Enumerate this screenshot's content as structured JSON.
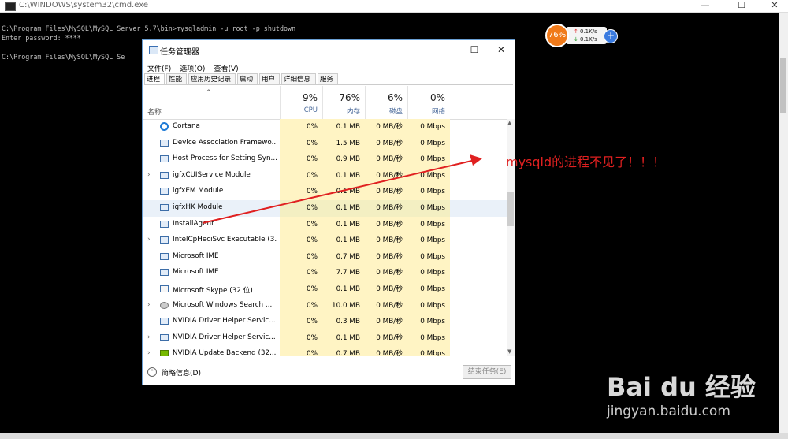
{
  "cmd": {
    "title": "C:\\WINDOWS\\system32\\cmd.exe",
    "lines": [
      "C:\\Program Files\\MySQL\\MySQL Server 5.7\\bin>mysqladmin -u root -p shutdown",
      "Enter password: ****",
      "",
      "C:\\Program Files\\MySQL\\MySQL Se"
    ],
    "min": "—",
    "max": "☐",
    "close": "✕"
  },
  "net_widget": {
    "percent": "76%",
    "up": "0.1K/s",
    "down": "0.1K/s",
    "plus": "+"
  },
  "taskmgr": {
    "title": "任务管理器",
    "min": "—",
    "max": "☐",
    "close": "✕",
    "menu": [
      "文件(F)",
      "选项(O)",
      "查看(V)"
    ],
    "tabs": [
      "进程",
      "性能",
      "应用历史记录",
      "启动",
      "用户",
      "详细信息",
      "服务"
    ],
    "columns": {
      "name": "名称",
      "sort_arrow": "^",
      "cpu": {
        "pct": "9%",
        "label": "CPU"
      },
      "mem": {
        "pct": "76%",
        "label": "内存"
      },
      "disk": {
        "pct": "6%",
        "label": "磁盘"
      },
      "net": {
        "pct": "0%",
        "label": "网络"
      }
    },
    "rows": [
      {
        "name": "Cortana",
        "expand": "",
        "icon": "cortana",
        "cpu": "0%",
        "mem": "0.1 MB",
        "disk": "0 MB/秒",
        "net": "0 Mbps"
      },
      {
        "name": "Device Association Framewo...",
        "expand": "",
        "icon": "app",
        "cpu": "0%",
        "mem": "1.5 MB",
        "disk": "0 MB/秒",
        "net": "0 Mbps"
      },
      {
        "name": "Host Process for Setting Syn...",
        "expand": "",
        "icon": "app",
        "cpu": "0%",
        "mem": "0.9 MB",
        "disk": "0 MB/秒",
        "net": "0 Mbps"
      },
      {
        "name": "igfxCUIService Module",
        "expand": "›",
        "icon": "app",
        "cpu": "0%",
        "mem": "0.1 MB",
        "disk": "0 MB/秒",
        "net": "0 Mbps"
      },
      {
        "name": "igfxEM Module",
        "expand": "",
        "icon": "app",
        "cpu": "0%",
        "mem": "0.1 MB",
        "disk": "0 MB/秒",
        "net": "0 Mbps"
      },
      {
        "name": "igfxHK Module",
        "expand": "",
        "icon": "app",
        "cpu": "0%",
        "mem": "0.1 MB",
        "disk": "0 MB/秒",
        "net": "0 Mbps"
      },
      {
        "name": "InstallAgent",
        "expand": "",
        "icon": "app",
        "cpu": "0%",
        "mem": "0.1 MB",
        "disk": "0 MB/秒",
        "net": "0 Mbps"
      },
      {
        "name": "IntelCpHeciSvc Executable (3...",
        "expand": "›",
        "icon": "app",
        "cpu": "0%",
        "mem": "0.1 MB",
        "disk": "0 MB/秒",
        "net": "0 Mbps"
      },
      {
        "name": "Microsoft IME",
        "expand": "",
        "icon": "app",
        "cpu": "0%",
        "mem": "0.7 MB",
        "disk": "0 MB/秒",
        "net": "0 Mbps"
      },
      {
        "name": "Microsoft IME",
        "expand": "",
        "icon": "app",
        "cpu": "0%",
        "mem": "7.7 MB",
        "disk": "0 MB/秒",
        "net": "0 Mbps"
      },
      {
        "name": "Microsoft Skype (32 位)",
        "expand": "",
        "icon": "skype",
        "cpu": "0%",
        "mem": "0.1 MB",
        "disk": "0 MB/秒",
        "net": "0 Mbps"
      },
      {
        "name": "Microsoft Windows Search ...",
        "expand": "›",
        "icon": "search",
        "cpu": "0%",
        "mem": "10.0 MB",
        "disk": "0 MB/秒",
        "net": "0 Mbps"
      },
      {
        "name": "NVIDIA Driver Helper Servic...",
        "expand": "",
        "icon": "app",
        "cpu": "0%",
        "mem": "0.3 MB",
        "disk": "0 MB/秒",
        "net": "0 Mbps"
      },
      {
        "name": "NVIDIA Driver Helper Servic...",
        "expand": "›",
        "icon": "app",
        "cpu": "0%",
        "mem": "0.1 MB",
        "disk": "0 MB/秒",
        "net": "0 Mbps"
      },
      {
        "name": "NVIDIA Update Backend (32...",
        "expand": "›",
        "icon": "nvidia",
        "cpu": "0%",
        "mem": "0.7 MB",
        "disk": "0 MB/秒",
        "net": "0 Mbps"
      }
    ],
    "fewer_details": "简略信息(D)",
    "end_task": "结束任务(E)"
  },
  "annotation": {
    "text": "mysqld的进程不见了！！！",
    "color": "#e02020"
  },
  "watermark": {
    "brand": "Bai du 经验",
    "url": "jingyan.baidu.com"
  }
}
